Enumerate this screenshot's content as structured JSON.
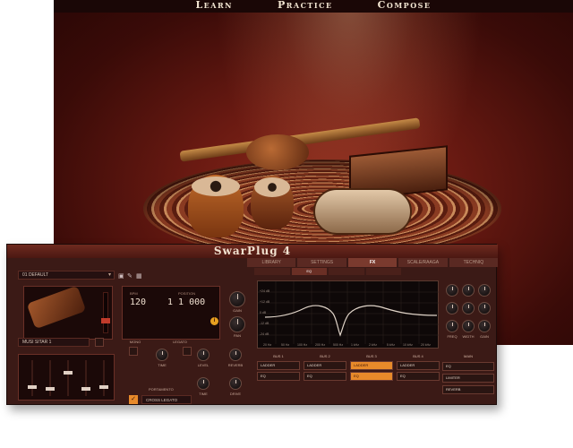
{
  "nav": {
    "items": [
      "Learn",
      "Practice",
      "Compose"
    ]
  },
  "plugin": {
    "title": "SwarPlug 4",
    "tabs": [
      {
        "label": "LIBRARY",
        "active": false
      },
      {
        "label": "SETTINGS",
        "active": false
      },
      {
        "label": "FX",
        "active": true
      },
      {
        "label": "SCALE/RAAGA",
        "active": false
      },
      {
        "label": "TECHNIQ",
        "active": false
      }
    ],
    "subtabs": [
      {
        "label": "",
        "active": false
      },
      {
        "label": "EQ",
        "active": true
      },
      {
        "label": "",
        "active": false
      },
      {
        "label": "",
        "active": false
      }
    ],
    "preset": "01 DEFAULT",
    "instrument_select": "MUSI SITAR 1",
    "bpm_label": "BPM",
    "position_label": "POSITION",
    "bpm": "120",
    "position": "1 1 000",
    "info_icon": "info-icon",
    "portamento_label": "PORTAMENTO",
    "legato_select": "CROSS LEGATO",
    "knob_labels": [
      "GAIN",
      "PAN",
      "TIME",
      "LEVEL",
      "REVERB",
      "TIME",
      "DRIVE"
    ],
    "mode_label": "MONO",
    "legato_label": "LEGATO",
    "big_knob_labels": [
      "FREQ",
      "WIDTH",
      "GAIN"
    ],
    "eq": {
      "y_labels": [
        "+24 dB",
        "+12 dB",
        "0 dB",
        "-12 dB",
        "-24 dB"
      ],
      "x_labels": [
        "20 Hz",
        "50 Hz",
        "100 Hz",
        "200 Hz",
        "500 Hz",
        "1 kHz",
        "2 kHz",
        "5 kHz",
        "10 kHz",
        "20 kHz"
      ]
    },
    "buses": [
      {
        "label": "BUS 1",
        "type": "LADDER",
        "fx": "EQ",
        "active": false
      },
      {
        "label": "BUS 2",
        "type": "LADDER",
        "fx": "EQ",
        "active": false
      },
      {
        "label": "BUS 3",
        "type": "LADDER",
        "fx": "EQ",
        "active": true
      },
      {
        "label": "BUS 4",
        "type": "LADDER",
        "fx": "EQ",
        "active": false
      }
    ],
    "main": {
      "label": "MAIN",
      "items": [
        "EQ",
        "LIMITER",
        "REVERB"
      ]
    },
    "colors": {
      "accent": "#e88a2a",
      "panel": "#3b1a16",
      "title_bar": "#6e2a1f"
    }
  }
}
